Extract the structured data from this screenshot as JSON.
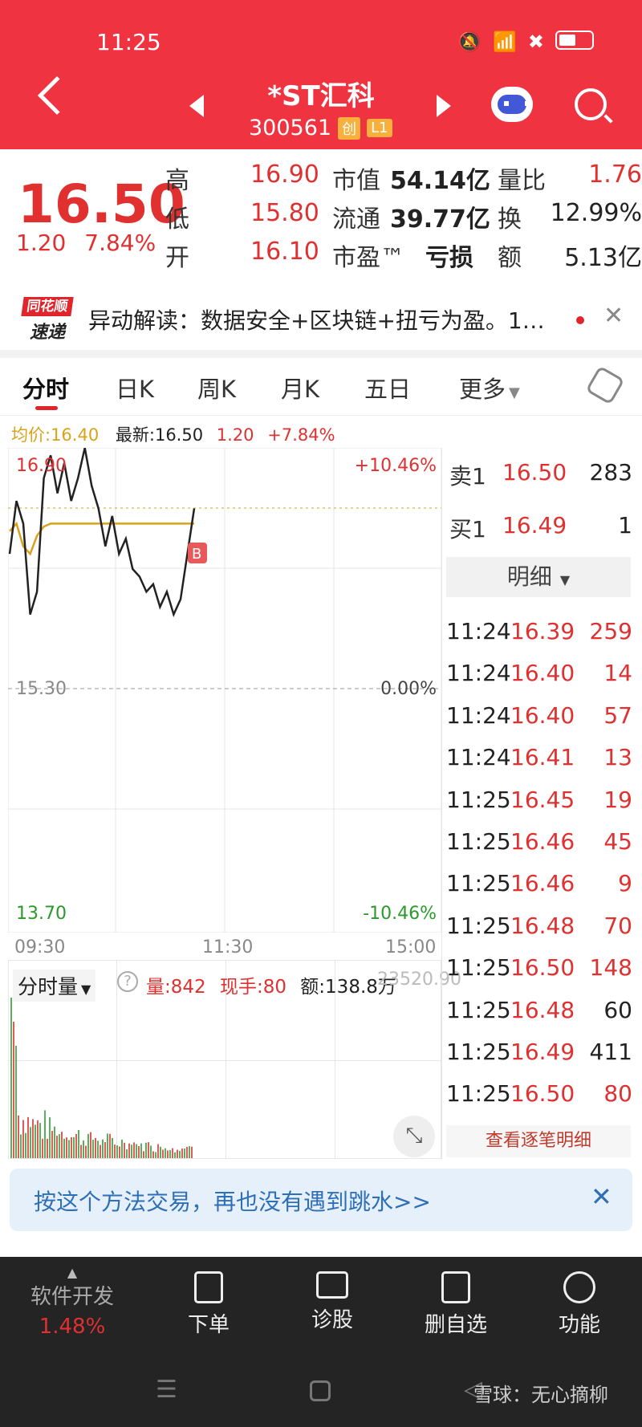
{
  "status_bar": {
    "time": "11:25"
  },
  "header": {
    "name": "*ST汇科",
    "code": "300561",
    "tag1": "创",
    "tag2": "L1"
  },
  "quote": {
    "price": "16.50",
    "change": "1.20",
    "change_pct": "7.84%",
    "high_label": "高",
    "high": "16.90",
    "low_label": "低",
    "low": "15.80",
    "open_label": "开",
    "open": "16.10",
    "mktcap_label": "市值",
    "mktcap": "54.14亿",
    "float_label": "流通",
    "float": "39.77亿",
    "pe_label": "市盈™",
    "pe": "亏损",
    "vr_label": "量比",
    "vr": "1.76",
    "turn_label": "换",
    "turn": "12.99%",
    "amt_label": "额",
    "amt": "5.13亿"
  },
  "news": {
    "logo_top": "同花顺",
    "logo_bottom": "速递",
    "text": "异动解读：数据安全+区块链+扭亏为盈。1…"
  },
  "tabs": [
    "分时",
    "日K",
    "周K",
    "月K",
    "五日",
    "更多"
  ],
  "chart_info": {
    "avg": "均价:16.40",
    "latest": "最新:16.50",
    "chg": "1.20",
    "chg_pct": "+7.84%"
  },
  "chart_axis": {
    "top": "16.90",
    "mid": "15.30",
    "bottom": "13.70",
    "top_pct": "+10.46%",
    "mid_pct": "0.00%",
    "bottom_pct": "-10.46%",
    "t0": "09:30",
    "t1": "11:30",
    "t2": "15:00",
    "marker": "B"
  },
  "chart_data": {
    "type": "line",
    "y_range": [
      13.7,
      16.9
    ],
    "series": [
      {
        "name": "price",
        "values": [
          16.2,
          16.55,
          16.4,
          15.8,
          15.95,
          16.7,
          16.85,
          16.6,
          16.8,
          16.55,
          16.7,
          16.9,
          16.65,
          16.5,
          16.25,
          16.45,
          16.2,
          16.3,
          16.1,
          16.05,
          15.95,
          16.0,
          15.85,
          15.95,
          15.8,
          15.9,
          16.2,
          16.5
        ]
      },
      {
        "name": "avg",
        "values": [
          16.35,
          16.4,
          16.25,
          16.2,
          16.32,
          16.38,
          16.4,
          16.4,
          16.4,
          16.4,
          16.4,
          16.4,
          16.4,
          16.4,
          16.4,
          16.4,
          16.4,
          16.4,
          16.4,
          16.4,
          16.4,
          16.4,
          16.4,
          16.4,
          16.4,
          16.4,
          16.4,
          16.4
        ]
      }
    ]
  },
  "orderbook": {
    "sell1_label": "卖1",
    "sell1_price": "16.50",
    "sell1_vol": "283",
    "buy1_label": "买1",
    "buy1_price": "16.49",
    "buy1_vol": "1",
    "detail_label": "明细",
    "trades": [
      {
        "t": "11:24",
        "p": "16.39",
        "v": "259"
      },
      {
        "t": "11:24",
        "p": "16.40",
        "v": "14"
      },
      {
        "t": "11:24",
        "p": "16.40",
        "v": "57"
      },
      {
        "t": "11:24",
        "p": "16.41",
        "v": "13"
      },
      {
        "t": "11:25",
        "p": "16.45",
        "v": "19"
      },
      {
        "t": "11:25",
        "p": "16.46",
        "v": "45"
      },
      {
        "t": "11:25",
        "p": "16.46",
        "v": "9"
      },
      {
        "t": "11:25",
        "p": "16.48",
        "v": "70"
      },
      {
        "t": "11:25",
        "p": "16.50",
        "v": "148"
      },
      {
        "t": "11:25",
        "p": "16.48",
        "v": "60"
      },
      {
        "t": "11:25",
        "p": "16.49",
        "v": "411"
      },
      {
        "t": "11:25",
        "p": "16.50",
        "v": "80"
      }
    ],
    "view_all": "查看逐笔明细"
  },
  "volume": {
    "label": "分时量",
    "vol": "量:842",
    "hand": "现手:80",
    "amt": "额:138.8万",
    "right": "23520.90"
  },
  "banner": {
    "text": "按这个方法交易，再也没有遇到跳水>>"
  },
  "bottom": {
    "item0_label": "软件开发",
    "item0_value": "1.48%",
    "item1": "下单",
    "item2": "诊股",
    "item3": "删自选",
    "item4": "功能",
    "watermark": "雪球：无心摘柳"
  }
}
